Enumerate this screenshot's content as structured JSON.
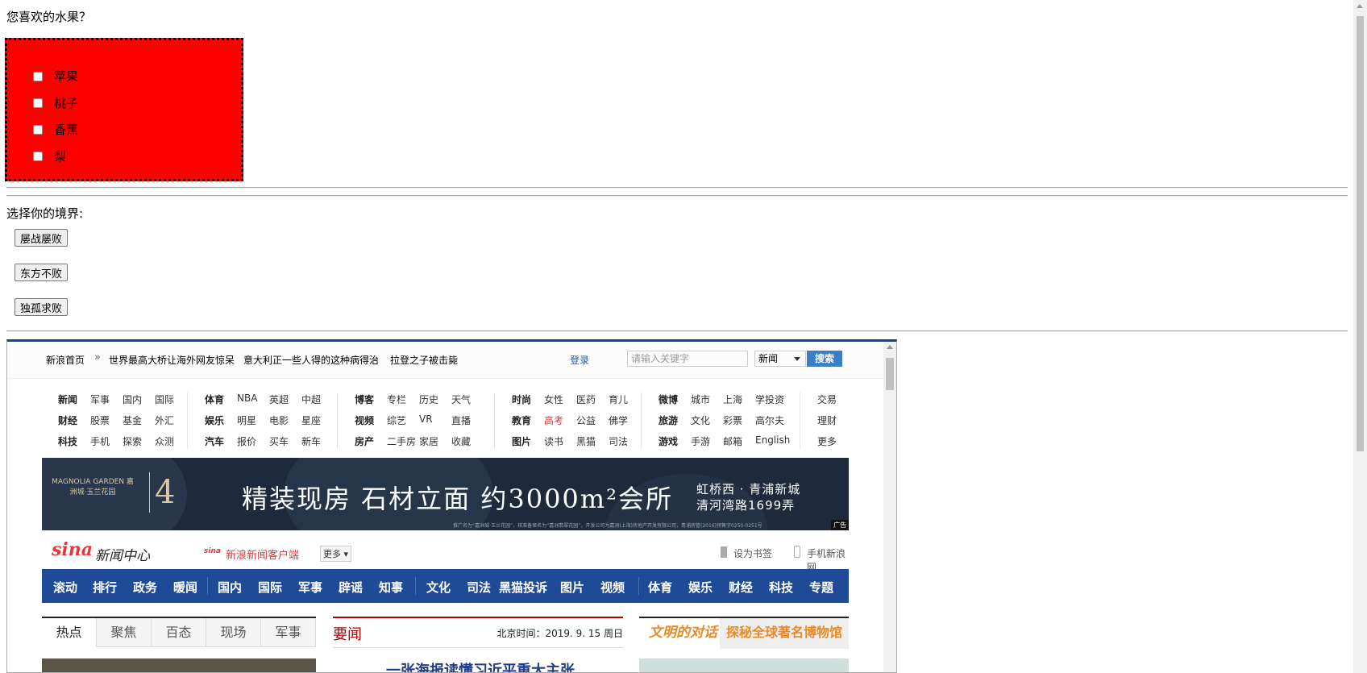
{
  "form": {
    "question1": "您喜欢的水果？",
    "fruits": [
      "苹果",
      "桃子",
      "香蕉",
      "梨"
    ],
    "question2": "选择你的境界:",
    "buttons": [
      "屡战屡败",
      "东方不败",
      "独孤求败"
    ]
  },
  "sina": {
    "topbar": {
      "home": "新浪首页",
      "headlines": [
        "世界最高大桥让海外网友惊呆",
        "意大利正一些人得的这种病得治",
        "拉登之子被击毙"
      ],
      "login": "登录",
      "search_placeholder": "请输入关键字",
      "search_select": "新闻",
      "search_button": "搜索"
    },
    "nav": [
      [
        [
          "新闻",
          "军事",
          "国内",
          "国际"
        ],
        [
          "财经",
          "股票",
          "基金",
          "外汇"
        ],
        [
          "科技",
          "手机",
          "探索",
          "众测"
        ]
      ],
      [
        [
          "体育",
          "NBA",
          "英超",
          "中超"
        ],
        [
          "娱乐",
          "明星",
          "电影",
          "星座"
        ],
        [
          "汽车",
          "报价",
          "买车",
          "新车"
        ]
      ],
      [
        [
          "博客",
          "专栏",
          "历史",
          "天气"
        ],
        [
          "视频",
          "综艺",
          "VR",
          "直播"
        ],
        [
          "房产",
          "二手房",
          "家居",
          "收藏"
        ]
      ],
      [
        [
          "时尚",
          "女性",
          "医药",
          "育儿"
        ],
        [
          "教育",
          "高考",
          "公益",
          "佛学"
        ],
        [
          "图片",
          "读书",
          "黑猫",
          "司法"
        ]
      ],
      [
        [
          "微博",
          "城市",
          "上海",
          "学投资"
        ],
        [
          "旅游",
          "文化",
          "彩票",
          "高尔夫"
        ],
        [
          "游戏",
          "手游",
          "邮箱",
          "English"
        ]
      ],
      [
        [
          "交易"
        ],
        [
          "理财"
        ],
        [
          "更多"
        ]
      ]
    ],
    "banner": {
      "brand": "MAGNOLIA GARDEN 嘉洲城·玉兰花园",
      "badge": "4",
      "main": "精装现房 石材立面 约3000m²会所",
      "right1": "虹桥西 · 青浦新城",
      "right2": "清河湾路1699弄",
      "small": "推广名为“嘉洲城·玉兰花园”，核准备案名为“嘉洲翡翠花园”，开发公司为嘉洲(上海)房地产开发有限公司，青浦房管(2016)预售字0250-0251号",
      "ad": "广告"
    },
    "header": {
      "logo": "sina",
      "center": "新闻中心",
      "client_icon": "sina",
      "client": "新浪新闻客户端",
      "more": "更多",
      "bookmark": "设为书签",
      "mobile": "手机新浪网"
    },
    "channels": [
      "滚动",
      "排行",
      "政务",
      "暖闻",
      "国内",
      "国际",
      "军事",
      "辟谣",
      "知事",
      "文化",
      "司法",
      "黑猫投诉",
      "图片",
      "视频",
      "体育",
      "娱乐",
      "财经",
      "科技",
      "专题"
    ],
    "tabs": [
      "热点",
      "聚焦",
      "百态",
      "现场",
      "军事"
    ],
    "news": {
      "title": "要闻",
      "clock": "北京时间：2019. 9. 15  周日",
      "headline": "一张海报读懂习近平重大主张"
    },
    "right": {
      "a": "文明的对话",
      "b": "探秘全球著名博物馆"
    }
  }
}
